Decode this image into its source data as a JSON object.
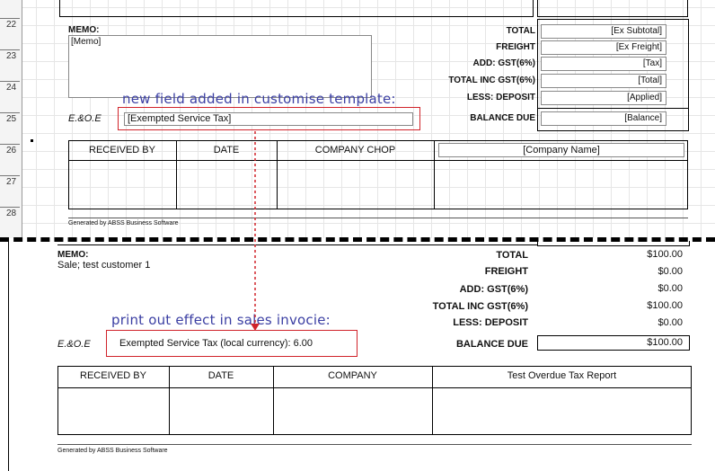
{
  "ruler": {
    "numbers": [
      "22",
      "23",
      "24",
      "25",
      "26",
      "27",
      "28"
    ]
  },
  "template": {
    "memo_label": "MEMO:",
    "memo_value": "[Memo]",
    "totals_labels": [
      "TOTAL",
      "FREIGHT",
      "ADD: GST(6%)",
      "TOTAL INC GST(6%)",
      "LESS: DEPOSIT",
      "BALANCE DUE"
    ],
    "totals_fields": [
      "[Ex Subtotal]",
      "[Ex Freight]",
      "[Tax]",
      "[Total]",
      "[Applied]",
      "[Balance]"
    ],
    "eoe": "E.&O.E",
    "exempt_field": "[Exempted Service Tax]",
    "annotation": "new field added in customise template:",
    "sign_headers": [
      "RECEIVED BY",
      "DATE",
      "COMPANY CHOP",
      "[Company Name]"
    ],
    "generated_by": "Generated by ABSS Business Software"
  },
  "printout": {
    "memo_label": "MEMO:",
    "memo_value": "Sale; test customer 1",
    "totals_labels": [
      "TOTAL",
      "FREIGHT",
      "ADD: GST(6%)",
      "TOTAL INC GST(6%)",
      "LESS: DEPOSIT",
      "BALANCE DUE"
    ],
    "totals_values": [
      "$100.00",
      "$0.00",
      "$0.00",
      "$100.00",
      "$0.00",
      "$100.00"
    ],
    "annotation": "print out effect in sales invocie:",
    "eoe": "E.&O.E",
    "exempt_text": "Exempted Service Tax (local currency): 6.00",
    "sign_headers": [
      "RECEIVED BY",
      "DATE",
      "COMPANY",
      "Test Overdue Tax Report"
    ],
    "generated_by": "Generated by ABSS Business Software"
  },
  "colors": {
    "annotation": "#3b3fa3",
    "highlight": "#d0232a",
    "arrow": "#d0232a"
  }
}
